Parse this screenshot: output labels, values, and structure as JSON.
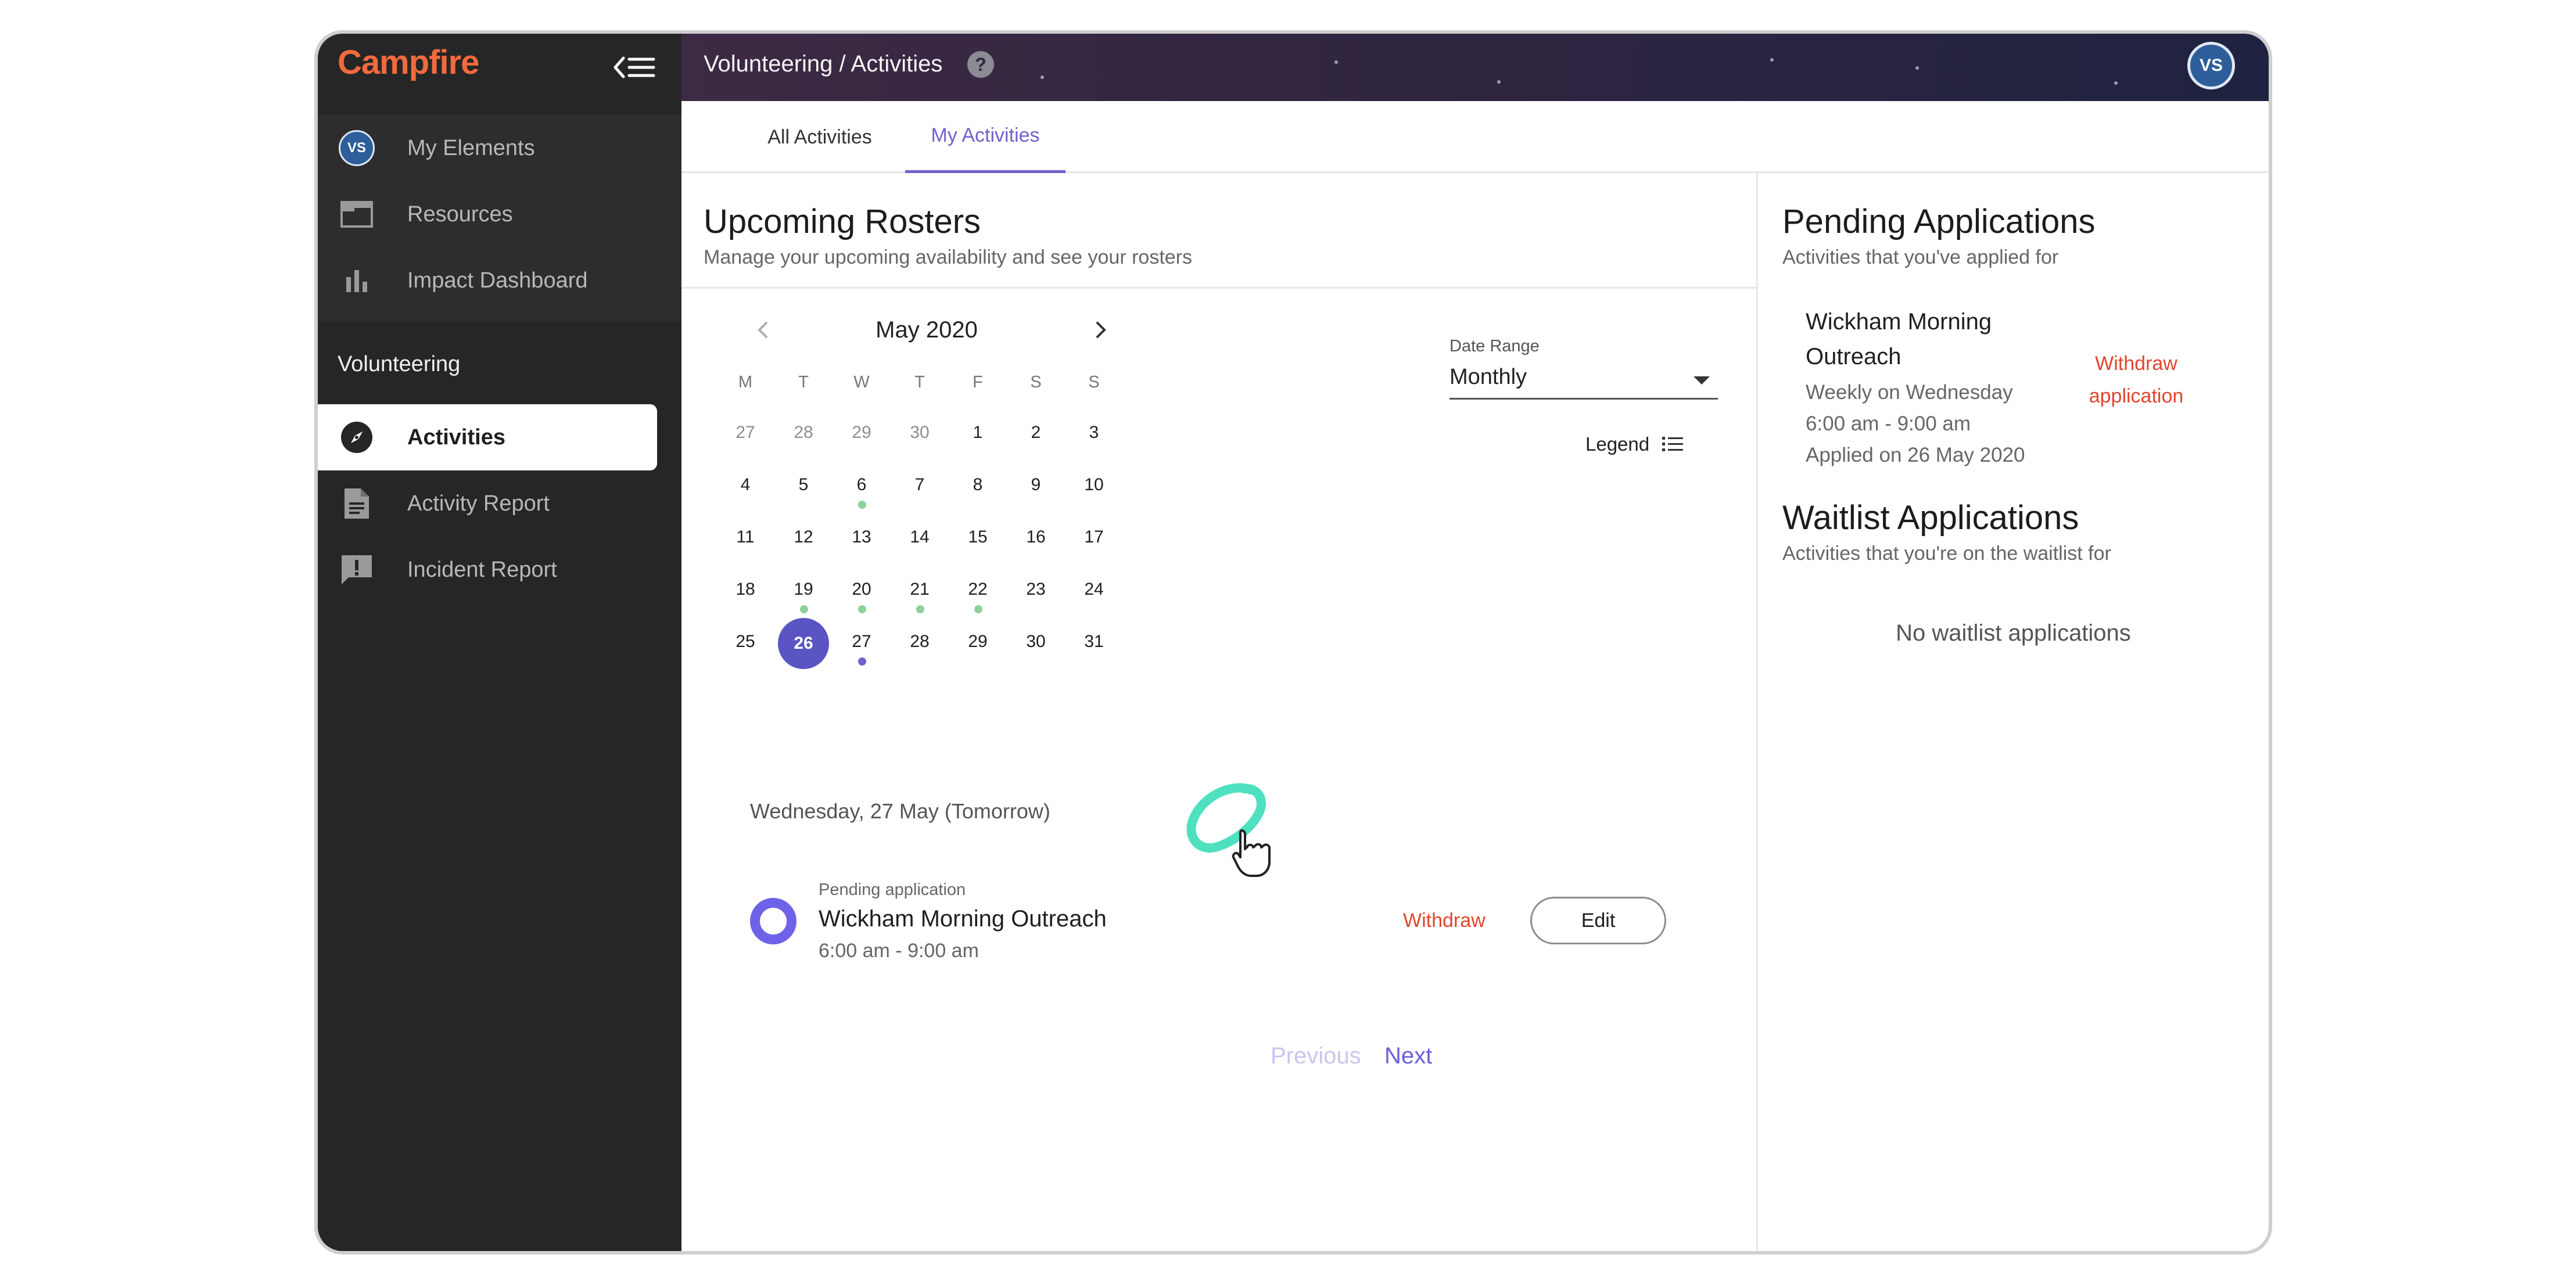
{
  "app": {
    "name": "Campfire"
  },
  "sidebar": {
    "top_items": [
      {
        "label": "My Elements",
        "icon": "avatar",
        "avatar_initials": "VS"
      },
      {
        "label": "Resources",
        "icon": "folder-icon"
      },
      {
        "label": "Impact Dashboard",
        "icon": "bar-chart-icon"
      }
    ],
    "section_label": "Volunteering",
    "section_items": [
      {
        "label": "Activities",
        "icon": "compass-icon",
        "active": true
      },
      {
        "label": "Activity Report",
        "icon": "document-icon"
      },
      {
        "label": "Incident Report",
        "icon": "report-alert-icon"
      }
    ]
  },
  "header": {
    "breadcrumb": "Volunteering / Activities",
    "help_icon": "?",
    "user_initials": "VS"
  },
  "tabs": [
    {
      "label": "All Activities",
      "active": false
    },
    {
      "label": "My Activities",
      "active": true
    }
  ],
  "rosters": {
    "title": "Upcoming Rosters",
    "subtitle": "Manage your upcoming availability and see your rosters",
    "calendar": {
      "month_label": "May 2020",
      "weekdays": [
        "M",
        "T",
        "W",
        "T",
        "F",
        "S",
        "S"
      ],
      "weeks": [
        [
          "27",
          "28",
          "29",
          "30",
          "1",
          "2",
          "3"
        ],
        [
          "4",
          "5",
          "6",
          "7",
          "8",
          "9",
          "10"
        ],
        [
          "11",
          "12",
          "13",
          "14",
          "15",
          "16",
          "17"
        ],
        [
          "18",
          "19",
          "20",
          "21",
          "22",
          "23",
          "24"
        ],
        [
          "25",
          "26",
          "27",
          "28",
          "29",
          "30",
          "31"
        ]
      ],
      "muted_days": [
        "27",
        "28",
        "29",
        "30"
      ],
      "dot_days": [
        "6",
        "19",
        "20",
        "21",
        "22",
        "27"
      ],
      "selected_day": "26",
      "highlighted_day": "27"
    },
    "date_range": {
      "label": "Date Range",
      "value": "Monthly"
    },
    "legend_label": "Legend",
    "selected_date_heading": "Wednesday, 27 May (Tomorrow)",
    "entry": {
      "status": "Pending application",
      "title": "Wickham Morning Outreach",
      "time": "6:00 am - 9:00 am",
      "withdraw_label": "Withdraw",
      "edit_label": "Edit"
    },
    "pagination": {
      "previous": "Previous",
      "next": "Next"
    }
  },
  "pending": {
    "title": "Pending Applications",
    "subtitle": "Activities that you've applied for",
    "item": {
      "title": "Wickham Morning Outreach",
      "schedule": "Weekly on Wednesday",
      "time": "6:00 am - 9:00 am",
      "applied": "Applied on 26 May 2020",
      "withdraw_label": "Withdraw application"
    }
  },
  "waitlist": {
    "title": "Waitlist Applications",
    "subtitle": "Activities that you're on the waitlist for",
    "empty": "No waitlist applications"
  },
  "colors": {
    "brand": "#f26a3e",
    "accent": "#6e63cf",
    "danger": "#e0462f",
    "sidebar_bg": "#262626",
    "event_dot": "#8fd19b",
    "highlight": "#4fe0c0"
  }
}
